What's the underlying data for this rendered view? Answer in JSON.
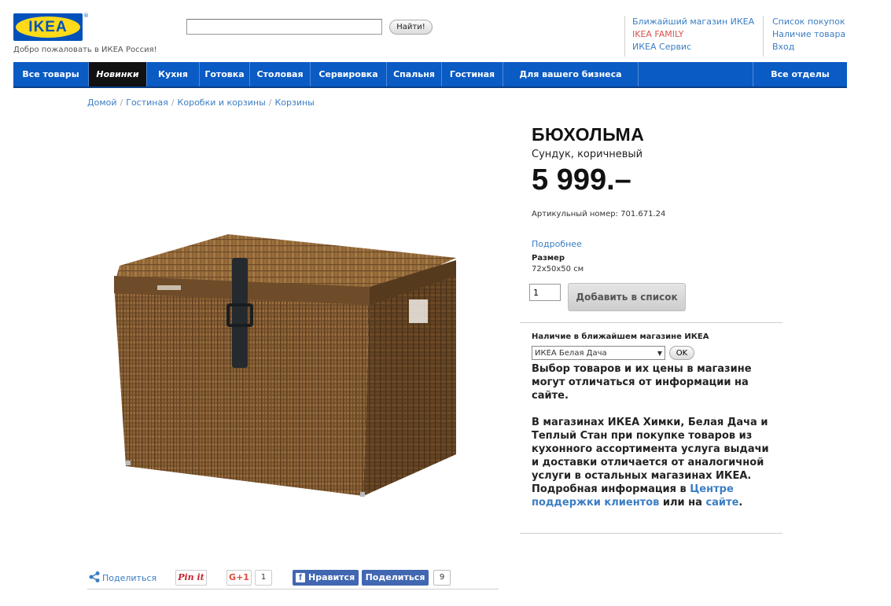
{
  "header": {
    "logo_text": "IKEA",
    "logo_reg": "®",
    "welcome": "Добро пожаловать в ИКЕА Россия!",
    "search": {
      "value": "",
      "button_label": "Найти!"
    },
    "links_col1": [
      "Ближайший магазин ИКЕА",
      "IKEA FAMILY",
      "ИКЕА Сервис"
    ],
    "links_col2": [
      "Список покупок",
      "Наличие товара",
      "Вход"
    ]
  },
  "nav": {
    "items": [
      "Все товары",
      "Новинки",
      "Кухня",
      "Готовка",
      "Столовая",
      "Сервировка",
      "Спальня",
      "Гостиная",
      "Для вашего бизнеса"
    ],
    "active": "Новинки",
    "right": "Все отделы"
  },
  "breadcrumb": [
    "Домой",
    "Гостиная",
    "Коробки и корзины",
    "Корзины"
  ],
  "product": {
    "name": "БЮХОЛЬМА",
    "subtitle": "Сундук, коричневый",
    "price": "5 999.–",
    "article": "Артикульный номер: 701.671.24",
    "more_link": "Подробнее",
    "size_label": "Размер",
    "size": "72x50x50 см",
    "quantity": "1",
    "add_button": "Добавить в список"
  },
  "availability": {
    "title": "Наличие в ближайшем магазине ИКЕА",
    "store_selected": "ИКЕА Белая Дача",
    "ok_label": "OK",
    "notice1": "Выбор товаров и их цены в магазине могут отличаться от информации на сайте.",
    "notice2_text": "В магазинах ИКЕА Химки, Белая Дача и Теплый Стан при покупке товаров из кухонного ассортимента услуга выдачи и доставки отличается от аналогичной услуги в остальных магазинах ИКЕА. Подробная информация в ",
    "notice2_link1": "Центре поддержки клиентов",
    "notice2_mid": " или на ",
    "notice2_link2": "сайте",
    "notice2_end": "."
  },
  "share": {
    "label": "Поделиться",
    "pinit": "Pin it",
    "gplus": "G+1",
    "gplus_count": "1",
    "fb_like": "Нравится",
    "fb_share": "Поделиться",
    "fb_count": "9"
  },
  "colors": {
    "nav_blue": "#0a5bc4",
    "link_blue": "#3b7dc3",
    "ikea_yellow": "#ffda1a",
    "family_red": "#d9534f"
  }
}
